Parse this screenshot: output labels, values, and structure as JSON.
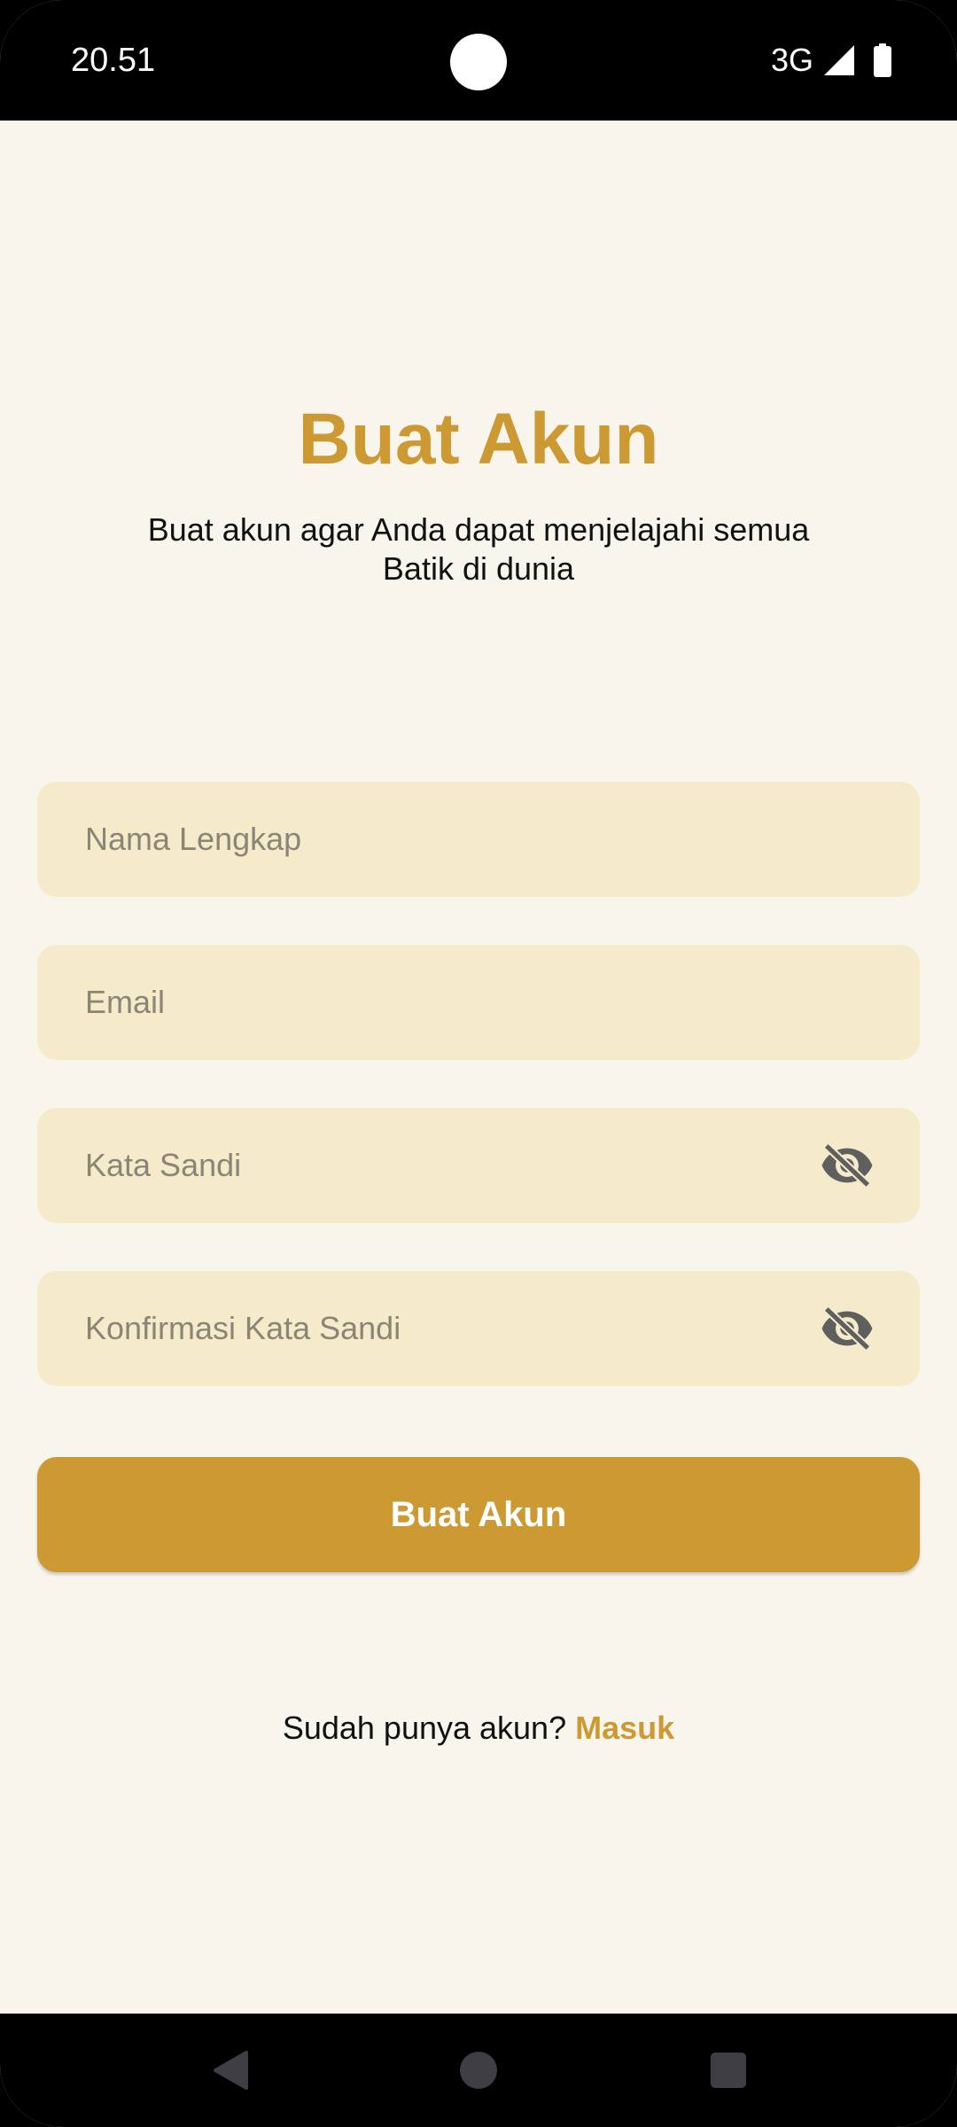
{
  "status_bar": {
    "time": "20.51",
    "network": "3G"
  },
  "header": {
    "title": "Buat Akun",
    "subtitle": "Buat akun agar Anda dapat menjelajahi semua Batik di dunia"
  },
  "form": {
    "full_name": {
      "placeholder": "Nama Lengkap",
      "value": ""
    },
    "email": {
      "placeholder": "Email",
      "value": ""
    },
    "password": {
      "placeholder": "Kata Sandi",
      "value": "",
      "toggle_icon": "eye-off-icon"
    },
    "confirm_password": {
      "placeholder": "Konfirmasi Kata Sandi",
      "value": "",
      "toggle_icon": "eye-off-icon"
    },
    "submit_label": "Buat Akun"
  },
  "footer": {
    "prompt": "Sudah punya akun?",
    "link_label": "Masuk"
  },
  "nav_bar": {
    "back_icon": "back-icon",
    "home_icon": "home-icon",
    "recents_icon": "recents-icon"
  },
  "colors": {
    "accent": "#CC9933",
    "background": "#F8F5EC",
    "field_background": "#F5EBCB"
  }
}
